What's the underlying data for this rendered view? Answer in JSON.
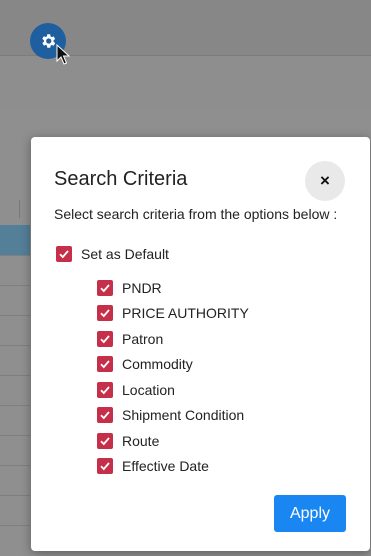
{
  "settings_button": {
    "icon": "gear-icon"
  },
  "modal": {
    "title": "Search Criteria",
    "close_label": "×",
    "subtitle": "Select search criteria from the options below :",
    "default_option": {
      "label": "Set as Default",
      "checked": true
    },
    "criteria": [
      {
        "label": "PNDR",
        "checked": true
      },
      {
        "label": "PRICE AUTHORITY",
        "checked": true
      },
      {
        "label": "Patron",
        "checked": true
      },
      {
        "label": "Commodity",
        "checked": true
      },
      {
        "label": "Location",
        "checked": true
      },
      {
        "label": "Shipment Condition",
        "checked": true
      },
      {
        "label": "Route",
        "checked": true
      },
      {
        "label": "Effective Date",
        "checked": true
      }
    ],
    "apply_label": "Apply"
  },
  "colors": {
    "checkbox": "#c62f4a",
    "apply": "#1a86f2",
    "gear_button": "#1f5fa0"
  }
}
